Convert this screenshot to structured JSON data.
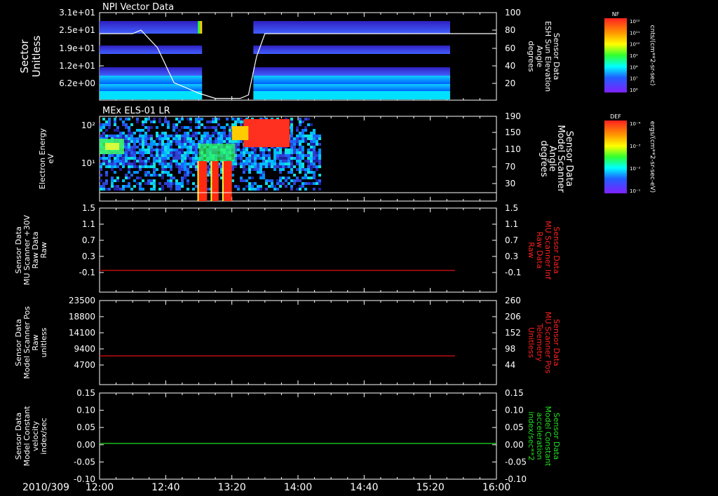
{
  "date_label": "2010/309",
  "x_ticks": [
    "12:00",
    "12:40",
    "13:20",
    "14:00",
    "14:40",
    "15:20",
    "16:00"
  ],
  "panels": [
    {
      "id": "npi",
      "title": "NPI Vector Data",
      "left_label": [
        "Sector",
        "Unitless"
      ],
      "left_ticks": [
        "3.1e+01",
        "2.5e+01",
        "1.9e+01",
        "1.2e+01",
        "6.2e+00"
      ],
      "right_ticks": [
        "100",
        "80",
        "60",
        "40",
        "20"
      ],
      "right_label": [
        "Sensor Data",
        "ESH Sun Elevation",
        "Angle",
        "degrees"
      ],
      "right_label_color": "#ffffff"
    },
    {
      "id": "els",
      "title": "MEx ELS-01 LR",
      "left_label": [
        "Electron Energy",
        "eV"
      ],
      "left_ticks": [
        "10²",
        "10¹"
      ],
      "right_ticks": [
        "190",
        "150",
        "110",
        "70",
        "30"
      ],
      "right_label": [
        "Sensor Data",
        "Model Scanner",
        "Angle",
        "degrees"
      ],
      "right_label_color": "#ffffff"
    },
    {
      "id": "mu-raw",
      "title": "",
      "left_label": [
        "Sensor Data",
        "MU Scanner +30V",
        "Raw Data",
        "Raw"
      ],
      "left_ticks": [
        "1.5",
        "1.1",
        "0.7",
        "0.3",
        "-0.1"
      ],
      "right_ticks": [
        "1.5",
        "1.1",
        "0.7",
        "0.3",
        "-0.1"
      ],
      "right_label": [
        "Sensor Data",
        "MU Scanner Inf",
        "Raw Data",
        "Raw"
      ],
      "right_label_color": "#ff2020"
    },
    {
      "id": "mu-pos",
      "title": "",
      "left_label": [
        "Sensor Data",
        "Model Scanner Pos",
        "Raw",
        "unitless"
      ],
      "left_ticks": [
        "23500",
        "18800",
        "14100",
        "9400",
        "4700"
      ],
      "right_ticks": [
        "260",
        "206",
        "152",
        "98",
        "44"
      ],
      "right_label": [
        "Sensor Data",
        "MU Scanner Pos",
        "Telemetry",
        "Unitless"
      ],
      "right_label_color": "#ff2020"
    },
    {
      "id": "const",
      "title": "",
      "left_label": [
        "Sensor Data",
        "Model Constant",
        "velocity",
        "index/sec"
      ],
      "left_ticks": [
        "0.15",
        "0.10",
        "0.05",
        "0.00",
        "-0.05",
        "-0.10"
      ],
      "right_ticks": [
        "0.15",
        "0.10",
        "0.05",
        "0.00",
        "-0.05",
        "-0.10"
      ],
      "right_label": [
        "Sensor Data",
        "Model Constant",
        "acceleration",
        "index/sec**2"
      ],
      "right_label_color": "#20e020"
    }
  ],
  "colorbars": [
    {
      "id": "nf",
      "tag": "NF",
      "ticks": [
        "10¹²",
        "10¹¹",
        "10¹⁰",
        "10⁹",
        "10⁸",
        "10⁷",
        "10⁶"
      ],
      "unit": "cnts/(cm**2-sr-sec)"
    },
    {
      "id": "def",
      "tag": "DEF",
      "ticks": [
        "10⁻⁴",
        "10⁻³",
        "10⁻²",
        "10⁻¹"
      ],
      "unit": "ergs/(cm**2-sr-sec-eV)"
    }
  ],
  "chart_data": [
    {
      "type": "heatmap",
      "title": "NPI Vector Data",
      "ylabel": "Sector Unitless",
      "y_right_label": "Sensor Data ESH Sun Elevation Angle degrees",
      "data_coverage": [
        [
          "12:00",
          "13:02"
        ],
        [
          "13:33",
          "15:32"
        ]
      ],
      "series": [
        {
          "name": "ESH Sun Elevation Angle",
          "x": [
            "12:00",
            "12:20",
            "12:25",
            "12:35",
            "12:45",
            "13:00",
            "13:10",
            "13:25",
            "13:30",
            "13:35",
            "13:40",
            "14:00",
            "15:32",
            "16:00"
          ],
          "values": [
            76,
            76,
            80,
            60,
            20,
            8,
            2,
            2,
            6,
            50,
            76,
            76,
            76,
            76
          ]
        }
      ]
    },
    {
      "type": "heatmap",
      "title": "MEx ELS-01 LR",
      "ylabel": "Electron Energy eV",
      "y_right_label": "Sensor Data Model Scanner Angle degrees",
      "data_coverage": [
        [
          "12:00",
          "14:13"
        ]
      ],
      "series": [
        {
          "name": "Model Scanner Angle",
          "x": [
            "12:00",
            "16:00"
          ],
          "values": [
            10,
            10
          ]
        }
      ]
    },
    {
      "type": "line",
      "ylabel": "Sensor Data MU Scanner +30V Raw Data Raw",
      "y_right_label": "Sensor Data MU Scanner Inf Raw Data Raw",
      "ylim": [
        -0.25,
        1.5
      ],
      "series": [
        {
          "name": "MU Scanner Inf",
          "x": [
            "12:00",
            "15:35"
          ],
          "values": [
            -0.1,
            -0.1
          ]
        }
      ]
    },
    {
      "type": "line",
      "ylabel": "Sensor Data Model Scanner Pos Raw unitless",
      "y_right_label": "Sensor Data MU Scanner Pos Telemetry Unitless",
      "ylim": [
        0,
        23500
      ],
      "series": [
        {
          "name": "MU Scanner Pos",
          "x": [
            "12:00",
            "15:35"
          ],
          "values": [
            8300,
            8300
          ]
        }
      ]
    },
    {
      "type": "line",
      "ylabel": "Sensor Data Model Constant velocity index/sec",
      "y_right_label": "Sensor Data Model Constant acceleration index/sec**2",
      "ylim": [
        -0.1,
        0.15
      ],
      "series": [
        {
          "name": "Model Constant acceleration",
          "x": [
            "12:00",
            "16:00"
          ],
          "values": [
            0,
            0
          ]
        }
      ]
    }
  ]
}
